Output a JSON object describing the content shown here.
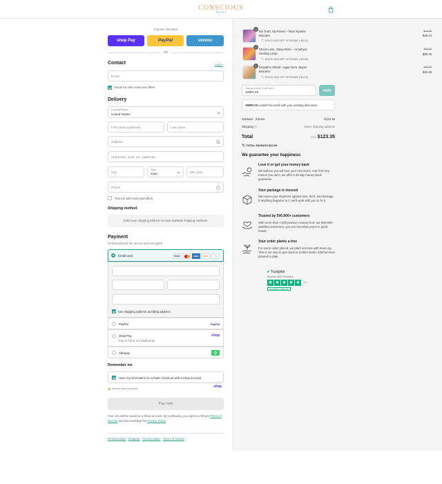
{
  "header": {
    "logo": "CONSCIOUS",
    "logo_sub": "Items",
    "bag_icon": "shopping-bag-icon"
  },
  "express": {
    "label": "Express checkout",
    "shop_pay": "shop Pay",
    "paypal": "PayPal",
    "venmo": "venmo",
    "or": "OR"
  },
  "contact": {
    "title": "Contact",
    "login": "Log in",
    "email_placeholder": "Email",
    "news_label": "Email me with news and offers"
  },
  "delivery": {
    "title": "Delivery",
    "country_label": "Country/Region",
    "country_value": "United States",
    "first_name": "First name (optional)",
    "last_name": "Last name",
    "address": "Address",
    "apartment": "Apartment, suite, etc. (optional)",
    "city": "City",
    "state_label": "State",
    "state_value": "Iowa",
    "zip": "ZIP code",
    "phone": "Phone",
    "text_label": "Text me with news and offers"
  },
  "shipping": {
    "title": "Shipping method",
    "note": "Enter your shipping address to view available shipping methods."
  },
  "payment": {
    "title": "Payment",
    "subtitle": "All transactions are secure and encrypted.",
    "credit_card": "Credit card",
    "cards": [
      "VISA",
      "MC",
      "AMEX",
      "DISC"
    ],
    "more": "+1",
    "billing_label": "Use shipping address as billing address",
    "paypal": "PayPal",
    "paypal_logo": "PayPal",
    "shop_pay": "Shop Pay",
    "shop_pay_sub": "Pay in full or in installments",
    "shop_pay_logo": "shop",
    "afterpay": "Afterpay"
  },
  "remember": {
    "title": "Remember me",
    "save_label": "Save my information for a faster checkout with a Shop account",
    "secure": "Secure and encrypted",
    "shop_logo": "shop"
  },
  "pay_now": "Pay now",
  "legal": {
    "text": "Your info will be saved to a Shop account. By continuing, you agree to Shop's",
    "terms": "Terms of Service",
    "and": "and acknowledge the",
    "privacy": "Privacy Policy"
  },
  "footer_links": [
    "Refund policy",
    "Shipping",
    "Privacy policy",
    "Terms of service"
  ],
  "cart": {
    "items": [
      {
        "qty": "1",
        "name": "My Truth, My Power – Rare Kyanite Bracelet",
        "old": "$44.46",
        "price": "$38.24",
        "discount": "ENJOY $20 OFF SITEWIDE (-$6.21)"
      },
      {
        "qty": "1",
        "name": "Stress Less, Sleep More – Amethyst Healing Lamp",
        "old": "$65.45",
        "price": "$59.76",
        "discount": "ENJOY $20 OFF SITEWIDE (-$9.69)"
      },
      {
        "qty": "1",
        "name": "Empath's Shield - Aqua Terra Jasper Bracelet",
        "old": "$29.45",
        "price": "$25.35",
        "discount": "ENJOY $20 OFF SITEWIDE (-$4.10)"
      }
    ],
    "discount_label": "Discount code or gift card",
    "discount_value": "SIMPLY5",
    "apply": "Apply",
    "code_msg_code": "SIMPLY5",
    "code_msg": "couldn't be used with your existing discounts.",
    "subtotal_label": "Subtotal · 3 items",
    "subtotal": "$123.35",
    "shipping_label": "Shipping",
    "shipping_value": "Enter shipping address",
    "total_label": "Total",
    "currency": "USD",
    "total": "$123.35",
    "savings_label": "TOTAL SAVINGS",
    "savings": "$20.00"
  },
  "guarantee": {
    "title": "We guarantee your happiness",
    "items": [
      {
        "icon": "handshake-money-icon",
        "title": "Love it or get your money back",
        "text": "We believe you will love your new items. And if for any reason you don't, we offer a 30-day money-back guarantee."
      },
      {
        "icon": "package-icon",
        "title": "Your package is insured",
        "text": "We insure your shipment against loss, theft, and damage. If anything happens to it, we'll work with you to fix it."
      },
      {
        "icon": "heart-hands-icon",
        "title": "Trusted by 500.000+ customers",
        "text": "With more than 7,000 positive reviews from our 500,000+ satisfied customers, you can trust that you're in good hands."
      },
      {
        "icon": "plant-hand-icon",
        "title": "Your order plants a tree",
        "text": "For every order placed, we plant one tree with trees.org. This is our way to give back to mother Earth. 439754 trees planted to date."
      }
    ],
    "trustpilot": "Trustpilot",
    "tp_reviews": "Reviews 982 • Excellent",
    "tp_score": "4.8",
    "tp_verified": "VERIFIED COMPANY",
    "stars": 5
  },
  "colors": {
    "accent": "#2a9d8f",
    "shop_pay": "#5a31f4",
    "paypal": "#ffc439",
    "venmo": "#3d95ce",
    "trust": "#00b67a"
  }
}
